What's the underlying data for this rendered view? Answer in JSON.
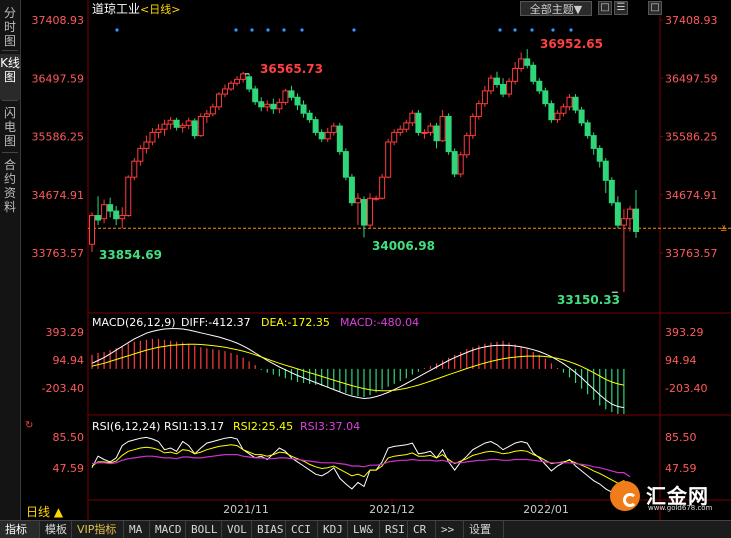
{
  "sidebar": {
    "tabs": [
      {
        "label": "分时图",
        "active": false
      },
      {
        "label": "K线图",
        "active": true
      },
      {
        "label": "闪电图",
        "active": false
      },
      {
        "label": "合约资料",
        "active": false
      }
    ]
  },
  "header": {
    "title": "道琼工业",
    "period": "<日线>",
    "theme_button": "全部主题▼",
    "buttons": [
      "□",
      "☰",
      "□"
    ]
  },
  "price_panel": {
    "y_ticks": [
      "37408.93",
      "36497.59",
      "35586.25",
      "34674.91",
      "33763.57"
    ],
    "ref_price": 34150,
    "annotations": {
      "high": "36565.73",
      "peak": "36952.65",
      "low_start": "33854.69",
      "low_mid": "34006.98",
      "low_end": "33150.33"
    }
  },
  "macd": {
    "label": "MACD(26,12,9)",
    "diff": "DIFF:-412.37",
    "dea": "DEA:-172.35",
    "macd": "MACD:-480.04",
    "y_ticks": [
      "393.29",
      "94.94",
      "-203.40"
    ]
  },
  "rsi": {
    "label": "RSI(6,12,24)",
    "rsi1": "RSI1:13.17",
    "rsi2": "RSI2:25.45",
    "rsi3": "RSI3:37.04",
    "y_ticks": [
      "85.50",
      "47.59"
    ]
  },
  "x_axis": {
    "labels": [
      "2021/11",
      "2021/12",
      "2022/01"
    ]
  },
  "period_label": "日线 ▲",
  "bottom_tabs": [
    "指标",
    "模板",
    "VIP指标",
    "MA",
    "MACD",
    "BOLL",
    "VOL",
    "BIAS",
    "CCI",
    "KDJ",
    "LW&",
    "RSI",
    "CR",
    ">>",
    "设置"
  ],
  "logo": {
    "name": "汇金网",
    "url": "www.gold678.com"
  },
  "colors": {
    "up": "#ff3b3b",
    "down": "#2fd67a",
    "ref_line": "#ff8c00",
    "macd_dea": "#ffff00",
    "rsi2": "#ffff00",
    "rsi3": "#cc33cc"
  },
  "chart_data": {
    "type": "candlestick",
    "title": "道琼工业 <日线>",
    "ylim": [
      33150,
      37409
    ],
    "candles": [
      [
        33900,
        34350,
        33780,
        34400
      ],
      [
        34350,
        34280,
        34200,
        34650
      ],
      [
        34300,
        34520,
        34230,
        34600
      ],
      [
        34520,
        34420,
        34320,
        34630
      ],
      [
        34420,
        34300,
        34200,
        34500
      ],
      [
        34300,
        34350,
        34150,
        34480
      ],
      [
        34350,
        34950,
        34330,
        34980
      ],
      [
        34950,
        35200,
        34900,
        35250
      ],
      [
        35200,
        35400,
        35130,
        35450
      ],
      [
        35400,
        35500,
        35320,
        35600
      ],
      [
        35500,
        35650,
        35450,
        35720
      ],
      [
        35650,
        35700,
        35560,
        35780
      ],
      [
        35700,
        35780,
        35600,
        35850
      ],
      [
        35780,
        35840,
        35700,
        35890
      ],
      [
        35840,
        35730,
        35680,
        35880
      ],
      [
        35730,
        35760,
        35650,
        35800
      ],
      [
        35760,
        35830,
        35700,
        35880
      ],
      [
        35830,
        35600,
        35550,
        35870
      ],
      [
        35600,
        35900,
        35580,
        35950
      ],
      [
        35900,
        35940,
        35800,
        36000
      ],
      [
        35940,
        36050,
        35900,
        36100
      ],
      [
        36050,
        36250,
        36000,
        36280
      ],
      [
        36250,
        36330,
        36200,
        36400
      ],
      [
        36330,
        36420,
        36300,
        36460
      ],
      [
        36420,
        36480,
        36380,
        36530
      ],
      [
        36480,
        36566,
        36430,
        36600
      ],
      [
        36520,
        36330,
        36280,
        36570
      ],
      [
        36330,
        36130,
        36080,
        36380
      ],
      [
        36130,
        36050,
        35980,
        36200
      ],
      [
        36050,
        36090,
        35980,
        36150
      ],
      [
        36090,
        36020,
        35940,
        36180
      ],
      [
        36020,
        36120,
        35950,
        36180
      ],
      [
        36120,
        36300,
        36080,
        36330
      ],
      [
        36300,
        36200,
        36150,
        36380
      ],
      [
        36200,
        36080,
        36000,
        36260
      ],
      [
        36080,
        35950,
        35880,
        36150
      ],
      [
        35950,
        35850,
        35800,
        36000
      ],
      [
        35850,
        35650,
        35600,
        35900
      ],
      [
        35650,
        35550,
        35500,
        35700
      ],
      [
        35550,
        35650,
        35500,
        35720
      ],
      [
        35650,
        35750,
        35600,
        35800
      ],
      [
        35750,
        35350,
        35300,
        35800
      ],
      [
        35350,
        34950,
        34900,
        35400
      ],
      [
        34950,
        34550,
        34500,
        35000
      ],
      [
        34550,
        34620,
        34200,
        34700
      ],
      [
        34600,
        34200,
        34007,
        34650
      ],
      [
        34200,
        34620,
        34150,
        34700
      ],
      [
        34620,
        34620,
        34580,
        34660
      ],
      [
        34620,
        34950,
        34600,
        35000
      ],
      [
        34950,
        35500,
        34930,
        35550
      ],
      [
        35500,
        35650,
        35450,
        35700
      ],
      [
        35650,
        35700,
        35600,
        35760
      ],
      [
        35700,
        35800,
        35650,
        35850
      ],
      [
        35800,
        35950,
        35750,
        36000
      ],
      [
        35950,
        35650,
        35600,
        36000
      ],
      [
        35650,
        35650,
        35550,
        35700
      ],
      [
        35650,
        35750,
        35600,
        35800
      ],
      [
        35750,
        35520,
        35400,
        35800
      ],
      [
        35520,
        35900,
        35500,
        36000
      ],
      [
        35900,
        35350,
        35300,
        35950
      ],
      [
        35350,
        35000,
        34950,
        35400
      ],
      [
        35000,
        35300,
        34950,
        35350
      ],
      [
        35300,
        35600,
        35250,
        35650
      ],
      [
        35600,
        35900,
        35550,
        35950
      ],
      [
        35900,
        36100,
        35850,
        36150
      ],
      [
        36100,
        36300,
        36050,
        36380
      ],
      [
        36300,
        36500,
        36250,
        36550
      ],
      [
        36500,
        36400,
        36350,
        36600
      ],
      [
        36400,
        36250,
        36200,
        36500
      ],
      [
        36250,
        36450,
        36200,
        36500
      ],
      [
        36450,
        36650,
        36400,
        36750
      ],
      [
        36650,
        36800,
        36600,
        36900
      ],
      [
        36800,
        36700,
        36650,
        36953
      ],
      [
        36700,
        36450,
        36400,
        36750
      ],
      [
        36450,
        36300,
        36250,
        36500
      ],
      [
        36300,
        36100,
        36050,
        36350
      ],
      [
        36100,
        35850,
        35800,
        36150
      ],
      [
        35850,
        35950,
        35800,
        36000
      ],
      [
        35950,
        36050,
        35900,
        36100
      ],
      [
        36050,
        36200,
        36000,
        36250
      ],
      [
        36200,
        36000,
        35950,
        36250
      ],
      [
        36000,
        35800,
        35750,
        36050
      ],
      [
        35800,
        35600,
        35550,
        35850
      ],
      [
        35600,
        35400,
        35300,
        35650
      ],
      [
        35400,
        35200,
        35100,
        35450
      ],
      [
        35200,
        34900,
        34700,
        35250
      ],
      [
        34900,
        34550,
        34500,
        34950
      ],
      [
        34550,
        34200,
        34150,
        34650
      ],
      [
        34200,
        34300,
        33150,
        34450
      ],
      [
        34300,
        34450,
        34100,
        34500
      ],
      [
        34450,
        34100,
        34000,
        34750
      ]
    ],
    "macd_bars": [
      150,
      170,
      180,
      200,
      220,
      240,
      270,
      290,
      300,
      310,
      320,
      320,
      310,
      300,
      290,
      280,
      270,
      250,
      230,
      220,
      210,
      200,
      190,
      170,
      150,
      120,
      80,
      40,
      -10,
      -40,
      -60,
      -80,
      -100,
      -120,
      -140,
      -150,
      -160,
      -170,
      -180,
      -200,
      -220,
      -240,
      -260,
      -280,
      -290,
      -300,
      -280,
      -250,
      -220,
      -190,
      -160,
      -130,
      -100,
      -60,
      -30,
      10,
      30,
      60,
      90,
      120,
      150,
      180,
      210,
      230,
      250,
      270,
      280,
      290,
      300,
      280,
      260,
      240,
      210,
      180,
      150,
      110,
      60,
      10,
      -40,
      -90,
      -150,
      -210,
      -270,
      -330,
      -390,
      -430,
      -460,
      -480,
      -480
    ],
    "dea": [
      30,
      45,
      60,
      80,
      100,
      120,
      140,
      160,
      180,
      200,
      215,
      230,
      240,
      250,
      255,
      260,
      262,
      262,
      260,
      255,
      248,
      240,
      230,
      218,
      205,
      190,
      172,
      150,
      128,
      105,
      82,
      60,
      40,
      20,
      0,
      -20,
      -40,
      -60,
      -80,
      -100,
      -120,
      -140,
      -160,
      -178,
      -195,
      -210,
      -222,
      -230,
      -233,
      -232,
      -227,
      -218,
      -205,
      -190,
      -172,
      -152,
      -130,
      -108,
      -85,
      -62,
      -40,
      -18,
      4,
      25,
      45,
      63,
      80,
      95,
      108,
      118,
      126,
      132,
      136,
      137,
      136,
      132,
      124,
      112,
      96,
      76,
      52,
      25,
      -6,
      -40,
      -76,
      -112,
      -140,
      -160,
      -172
    ],
    "diff": [
      60,
      90,
      120,
      160,
      200,
      240,
      280,
      320,
      350,
      380,
      400,
      415,
      425,
      430,
      430,
      425,
      415,
      400,
      385,
      370,
      355,
      340,
      320,
      300,
      275,
      245,
      210,
      170,
      130,
      90,
      55,
      20,
      -10,
      -40,
      -70,
      -95,
      -120,
      -145,
      -170,
      -195,
      -220,
      -245,
      -270,
      -290,
      -305,
      -315,
      -310,
      -295,
      -275,
      -250,
      -220,
      -190,
      -155,
      -120,
      -85,
      -50,
      -15,
      20,
      55,
      90,
      120,
      148,
      175,
      200,
      220,
      235,
      245,
      250,
      252,
      250,
      244,
      235,
      222,
      205,
      185,
      160,
      130,
      95,
      55,
      10,
      -40,
      -95,
      -155,
      -215,
      -275,
      -330,
      -375,
      -400,
      -412
    ],
    "rsi1": [
      48,
      62,
      58,
      55,
      60,
      75,
      80,
      82,
      84,
      85,
      83,
      80,
      70,
      72,
      68,
      80,
      75,
      65,
      72,
      78,
      80,
      82,
      84,
      85,
      83,
      70,
      65,
      60,
      62,
      58,
      65,
      72,
      68,
      60,
      55,
      50,
      45,
      40,
      38,
      42,
      48,
      35,
      28,
      22,
      30,
      25,
      45,
      45,
      55,
      72,
      74,
      75,
      76,
      78,
      65,
      66,
      68,
      60,
      70,
      55,
      45,
      55,
      62,
      70,
      74,
      78,
      80,
      76,
      70,
      74,
      78,
      80,
      78,
      66,
      60,
      52,
      44,
      50,
      54,
      58,
      50,
      44,
      38,
      32,
      28,
      22,
      18,
      14,
      30,
      13
    ],
    "rsi2": [
      50,
      55,
      55,
      54,
      56,
      63,
      68,
      70,
      72,
      73,
      72,
      70,
      66,
      67,
      65,
      70,
      69,
      65,
      67,
      70,
      72,
      74,
      75,
      76,
      75,
      70,
      67,
      64,
      64,
      62,
      64,
      67,
      66,
      62,
      59,
      56,
      52,
      49,
      47,
      48,
      50,
      46,
      42,
      38,
      40,
      37,
      45,
      45,
      50,
      60,
      62,
      63,
      64,
      66,
      62,
      62,
      63,
      60,
      64,
      58,
      53,
      56,
      59,
      63,
      65,
      67,
      68,
      67,
      65,
      66,
      68,
      69,
      68,
      64,
      61,
      57,
      53,
      54,
      55,
      57,
      54,
      51,
      48,
      44,
      41,
      37,
      33,
      29,
      32,
      25
    ],
    "rsi3": [
      53,
      54,
      54,
      53,
      54,
      57,
      59,
      60,
      61,
      62,
      62,
      61,
      60,
      60,
      59,
      61,
      61,
      60,
      60,
      61,
      62,
      63,
      64,
      64,
      64,
      62,
      61,
      60,
      60,
      59,
      59,
      60,
      60,
      59,
      58,
      57,
      56,
      55,
      54,
      54,
      54,
      53,
      52,
      50,
      50,
      49,
      51,
      51,
      52,
      55,
      56,
      57,
      57,
      58,
      57,
      57,
      57,
      56,
      57,
      55,
      54,
      54,
      55,
      56,
      57,
      57,
      58,
      58,
      57,
      57,
      58,
      58,
      58,
      57,
      56,
      55,
      54,
      54,
      54,
      54,
      53,
      52,
      51,
      49,
      48,
      46,
      44,
      42,
      42,
      37
    ]
  }
}
